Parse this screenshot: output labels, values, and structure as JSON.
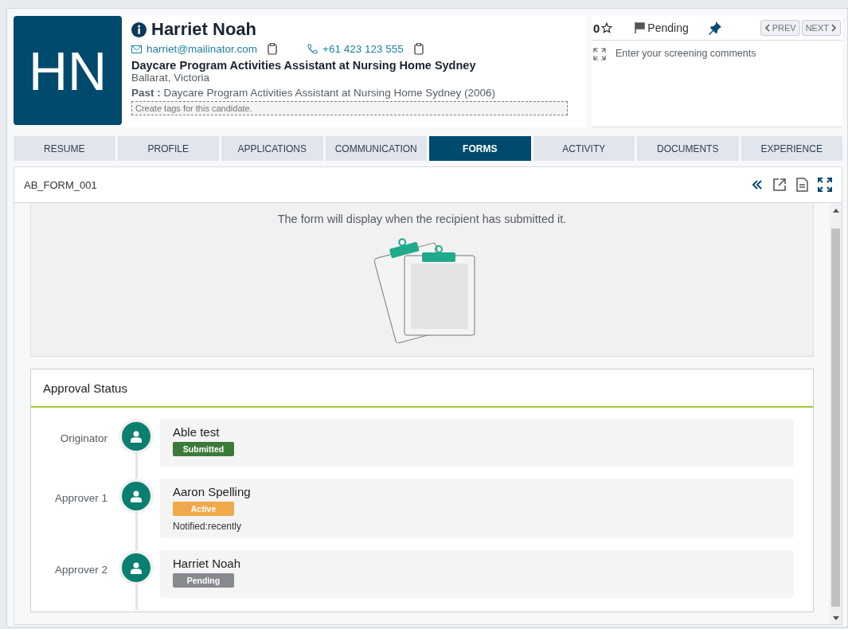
{
  "candidate": {
    "initials": "HN",
    "name": "Harriet Noah",
    "email": "harriet@mailinator.com",
    "phone": "+61 423 123 555",
    "headline": "Daycare Program Activities Assistant at Nursing Home Sydney",
    "location": "Ballarat, Victoria",
    "past_label": "Past :",
    "past": "Daycare Program Activities Assistant at Nursing Home Sydney (2006)",
    "tags_placeholder": "Create tags for this candidate."
  },
  "toolbar": {
    "rating": "0",
    "status": "Pending",
    "prev": "PREV",
    "next": "NEXT",
    "comments_placeholder": "Enter your screening comments"
  },
  "tabs": [
    {
      "label": "RESUME",
      "selected": false
    },
    {
      "label": "PROFILE",
      "selected": false
    },
    {
      "label": "APPLICATIONS",
      "selected": false
    },
    {
      "label": "COMMUNICATION",
      "selected": false
    },
    {
      "label": "FORMS",
      "selected": true
    },
    {
      "label": "ACTIVITY",
      "selected": false
    },
    {
      "label": "DOCUMENTS",
      "selected": false
    },
    {
      "label": "EXPERIENCE",
      "selected": false
    }
  ],
  "form": {
    "title": "AB_FORM_001",
    "message": "The form will display when the recipient has submitted it."
  },
  "approval": {
    "title": "Approval Status",
    "steps": [
      {
        "role": "Originator",
        "name": "Able test",
        "status": "Submitted",
        "color": "#3c7a3a"
      },
      {
        "role": "Approver 1",
        "name": "Aaron Spelling",
        "status": "Active",
        "color": "#f0a94a",
        "note": "Notified:recently"
      },
      {
        "role": "Approver 2",
        "name": "Harriet Noah",
        "status": "Pending",
        "color": "#868a8f"
      }
    ]
  }
}
